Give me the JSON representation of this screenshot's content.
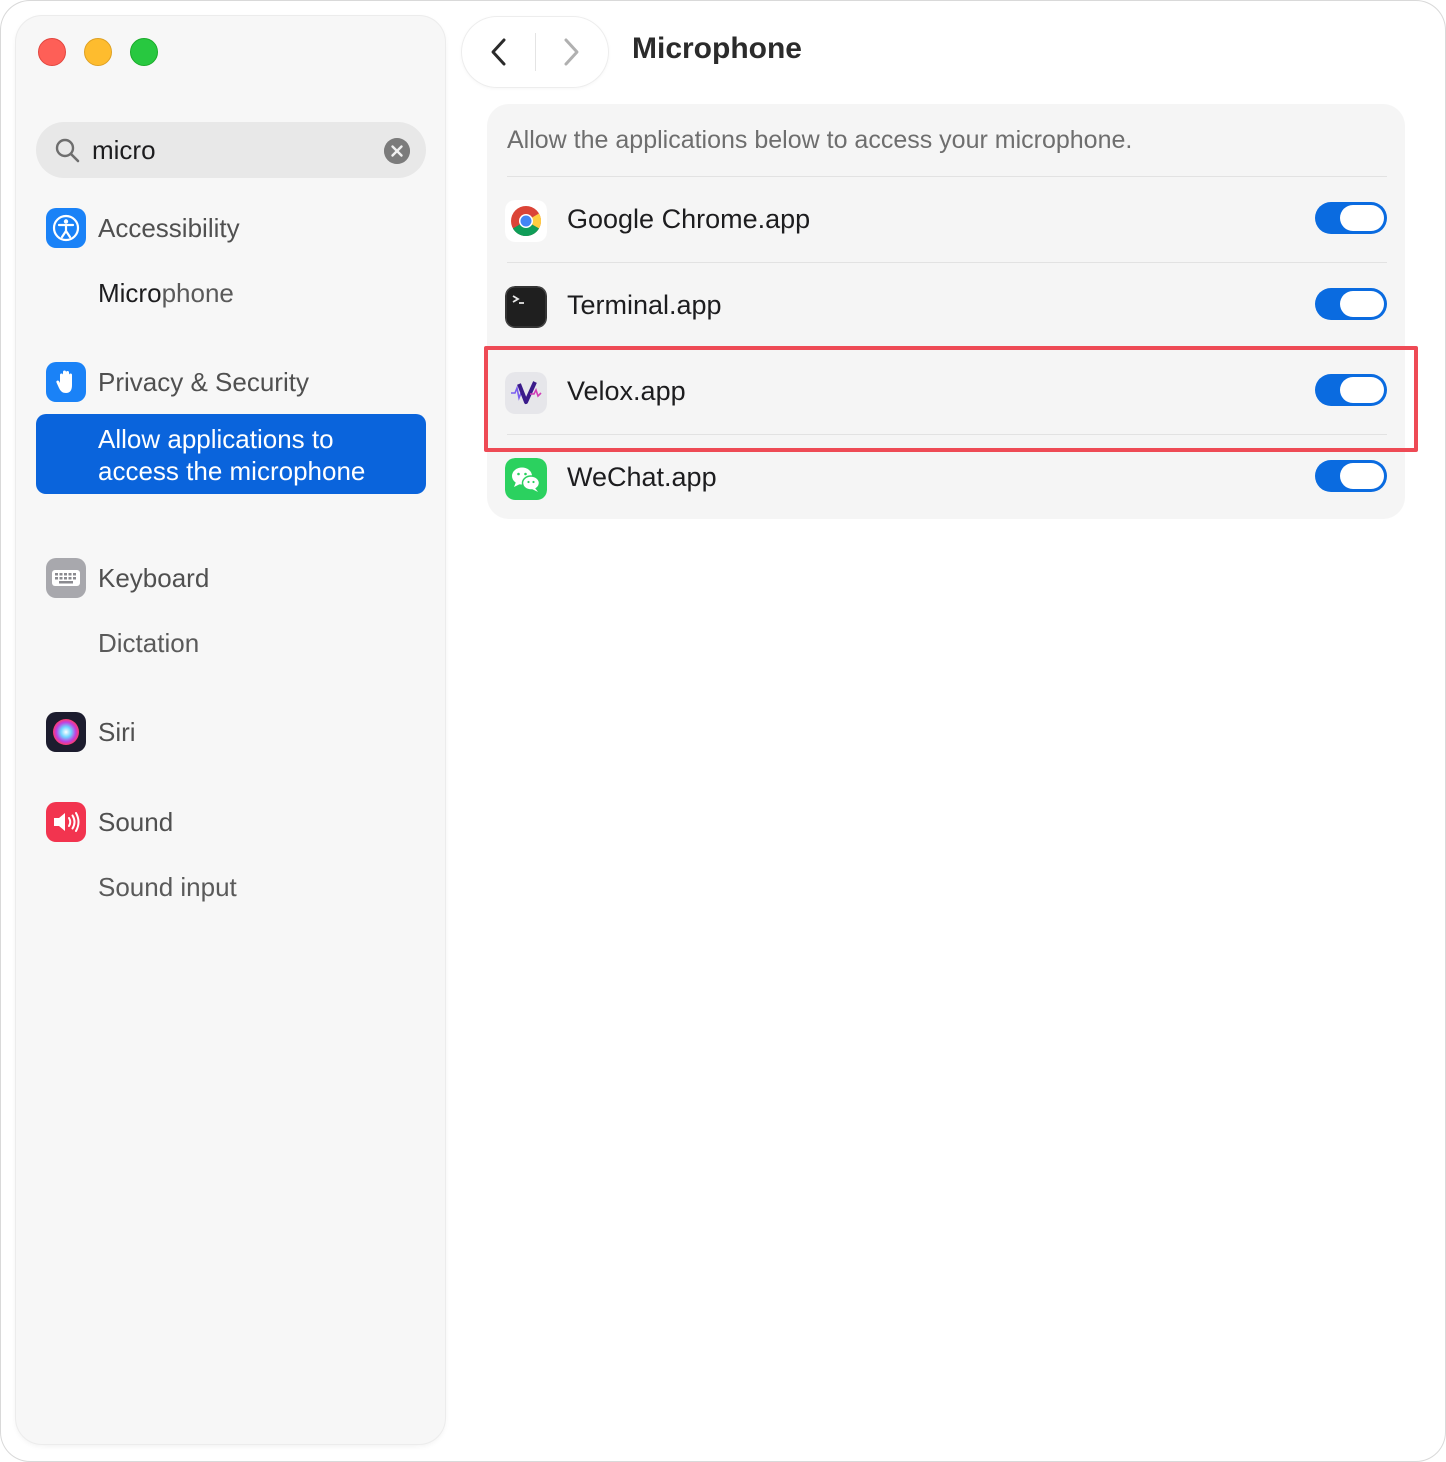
{
  "window": {
    "controls": {
      "close_color": "#fe5f57",
      "minimize_color": "#febc2e",
      "zoom_color": "#28c840"
    }
  },
  "sidebar": {
    "search": {
      "value": "micro",
      "icon": "search-icon",
      "clear_icon": "clear-icon"
    },
    "sections": [
      {
        "label": "Accessibility",
        "icon": "accessibility-icon",
        "sub": [
          {
            "match": "Micro",
            "rest": "phone"
          }
        ]
      },
      {
        "label": "Privacy & Security",
        "icon": "hand-icon",
        "selected_line1": "Allow applications to",
        "selected_line2": "access the microphone"
      },
      {
        "label": "Keyboard",
        "icon": "keyboard-icon",
        "sub": [
          {
            "text": "Dictation"
          }
        ]
      },
      {
        "label": "Siri",
        "icon": "siri-icon"
      },
      {
        "label": "Sound",
        "icon": "speaker-icon",
        "sub": [
          {
            "text": "Sound input"
          }
        ]
      }
    ]
  },
  "main": {
    "title": "Microphone",
    "description": "Allow the applications below to access your microphone.",
    "apps": [
      {
        "name": "Google Chrome.app",
        "icon": "chrome-icon",
        "enabled": true
      },
      {
        "name": "Terminal.app",
        "icon": "terminal-icon",
        "enabled": true
      },
      {
        "name": "Velox.app",
        "icon": "velox-icon",
        "enabled": true,
        "highlighted": true
      },
      {
        "name": "WeChat.app",
        "icon": "wechat-icon",
        "enabled": true
      }
    ],
    "accent_color": "#0a64dc",
    "highlight_color": "#ee4a55"
  }
}
